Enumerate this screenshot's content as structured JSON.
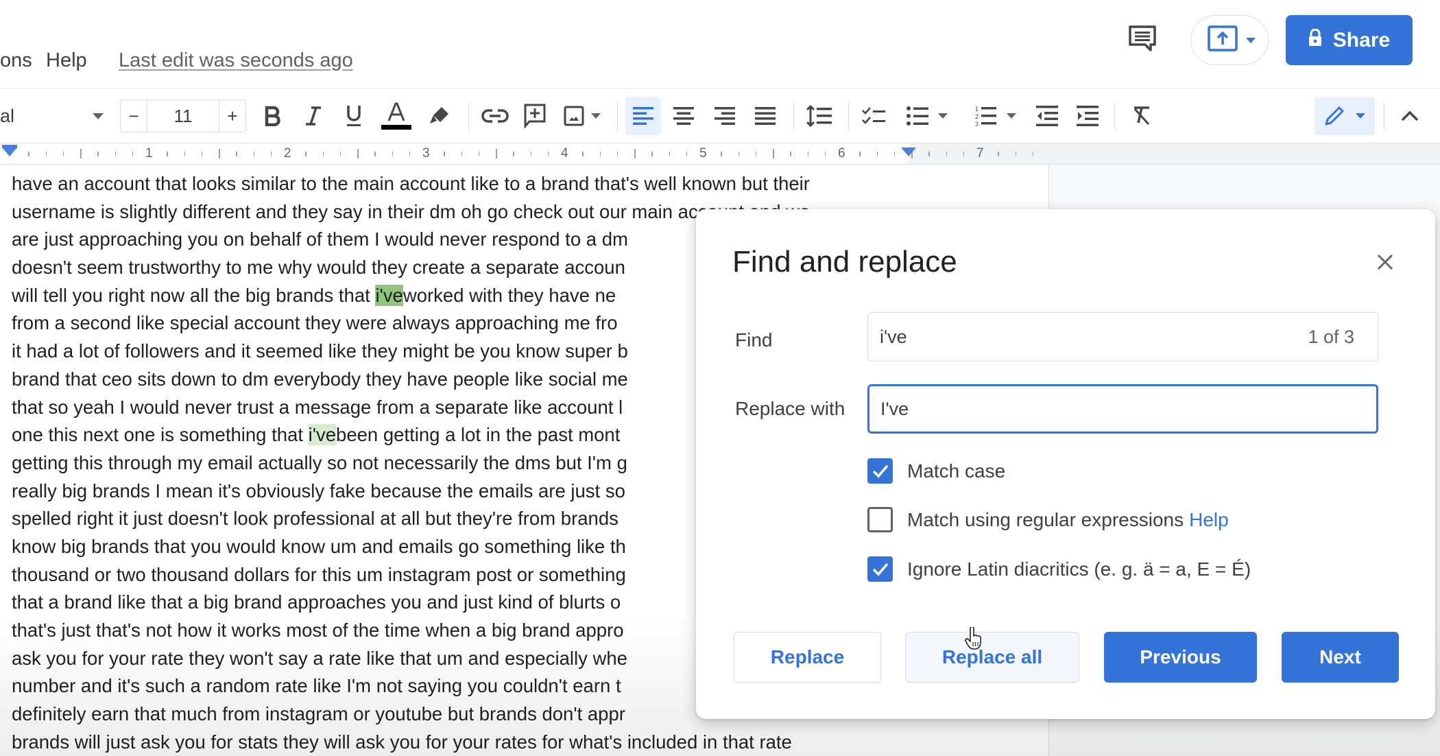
{
  "header": {
    "menu_partial": "ons",
    "menu_help": "Help",
    "last_edit": "Last edit was seconds ago",
    "share_label": "Share"
  },
  "toolbar": {
    "font_name": "al",
    "font_size": "11",
    "minus": "−",
    "plus": "+",
    "icons": [
      "bold-icon",
      "italic-icon",
      "underline-icon",
      "text-color-icon",
      "highlight-icon",
      "link-icon",
      "add-comment-icon",
      "insert-image-icon",
      "align-left-icon",
      "align-center-icon",
      "align-right-icon",
      "justify-icon",
      "line-spacing-icon",
      "checklist-icon",
      "bulleted-list-icon",
      "numbered-list-icon",
      "decrease-indent-icon",
      "increase-indent-icon",
      "clear-formatting-icon",
      "editing-mode-icon",
      "collapse-icon"
    ],
    "text_color": "#000000",
    "active_alignment": "left"
  },
  "ruler": {
    "numbers": [
      "1",
      "2",
      "3",
      "4",
      "5",
      "6",
      "7"
    ]
  },
  "document": {
    "lines": [
      {
        "text": "have an account that looks similar to the main account like to a brand that's well known but their"
      },
      {
        "text": "username is slightly different and they say in their dm oh go check out our main account and we"
      },
      {
        "text": "are just approaching you on behalf of them I would never respond to a dm"
      },
      {
        "text": "doesn't seem trustworthy to me why would they create a separate accoun"
      },
      {
        "before": "will tell you right now all the big brands that ",
        "match": "i've",
        "match_state": "current",
        "after": "worked with they have ne"
      },
      {
        "text": "from a second like special account they were always approaching me fro"
      },
      {
        "text": "it had a lot of followers and it seemed like they might be you know super b"
      },
      {
        "text": "brand that ceo sits down to dm everybody they have people like social me"
      },
      {
        "text": "that so yeah I would never trust a message from a separate like account l"
      },
      {
        "before": "one this next one is something that ",
        "match": "i've",
        "match_state": "other",
        "after": "been getting a lot in the past mont"
      },
      {
        "text": "getting this through my email actually so not necessarily the dms but I'm g"
      },
      {
        "text": "really big brands I mean it's obviously fake because the emails are just so"
      },
      {
        "text": "spelled right it just doesn't look professional at all but they're from brands"
      },
      {
        "text": "know big brands that you would know um and emails go something like th"
      },
      {
        "text": "thousand or two thousand dollars for this um instagram post or something"
      },
      {
        "text": "that a brand like that a big brand approaches you and just kind of blurts o"
      },
      {
        "text": "that's just that's not how it works most of the time when a big brand appro"
      },
      {
        "text": "ask you for your rate they won't say a rate like that um and especially whe"
      },
      {
        "text": "number and it's such a random rate like I'm not saying you couldn't earn t"
      },
      {
        "text": "definitely earn that much from instagram or youtube but brands don't appr"
      },
      {
        "text": "brands will just ask you for stats they will ask you for your rates for what's included in that rate"
      }
    ],
    "highlight_colors": {
      "current": "#93c47d",
      "other": "#d9ead3"
    }
  },
  "dialog": {
    "title": "Find and replace",
    "find_label": "Find",
    "find_value": "i've",
    "match_count": "1 of 3",
    "replace_label": "Replace with",
    "replace_value": "I've",
    "options": [
      {
        "label": "Match case",
        "checked": true
      },
      {
        "label": "Match using regular expressions",
        "checked": false,
        "link": "Help"
      },
      {
        "label": "Ignore Latin diacritics (e. g. ä = a, E = É)",
        "checked": true
      }
    ],
    "buttons": {
      "replace": "Replace",
      "replace_all": "Replace all",
      "previous": "Previous",
      "next": "Next"
    },
    "accent_color": "#3474d8"
  }
}
